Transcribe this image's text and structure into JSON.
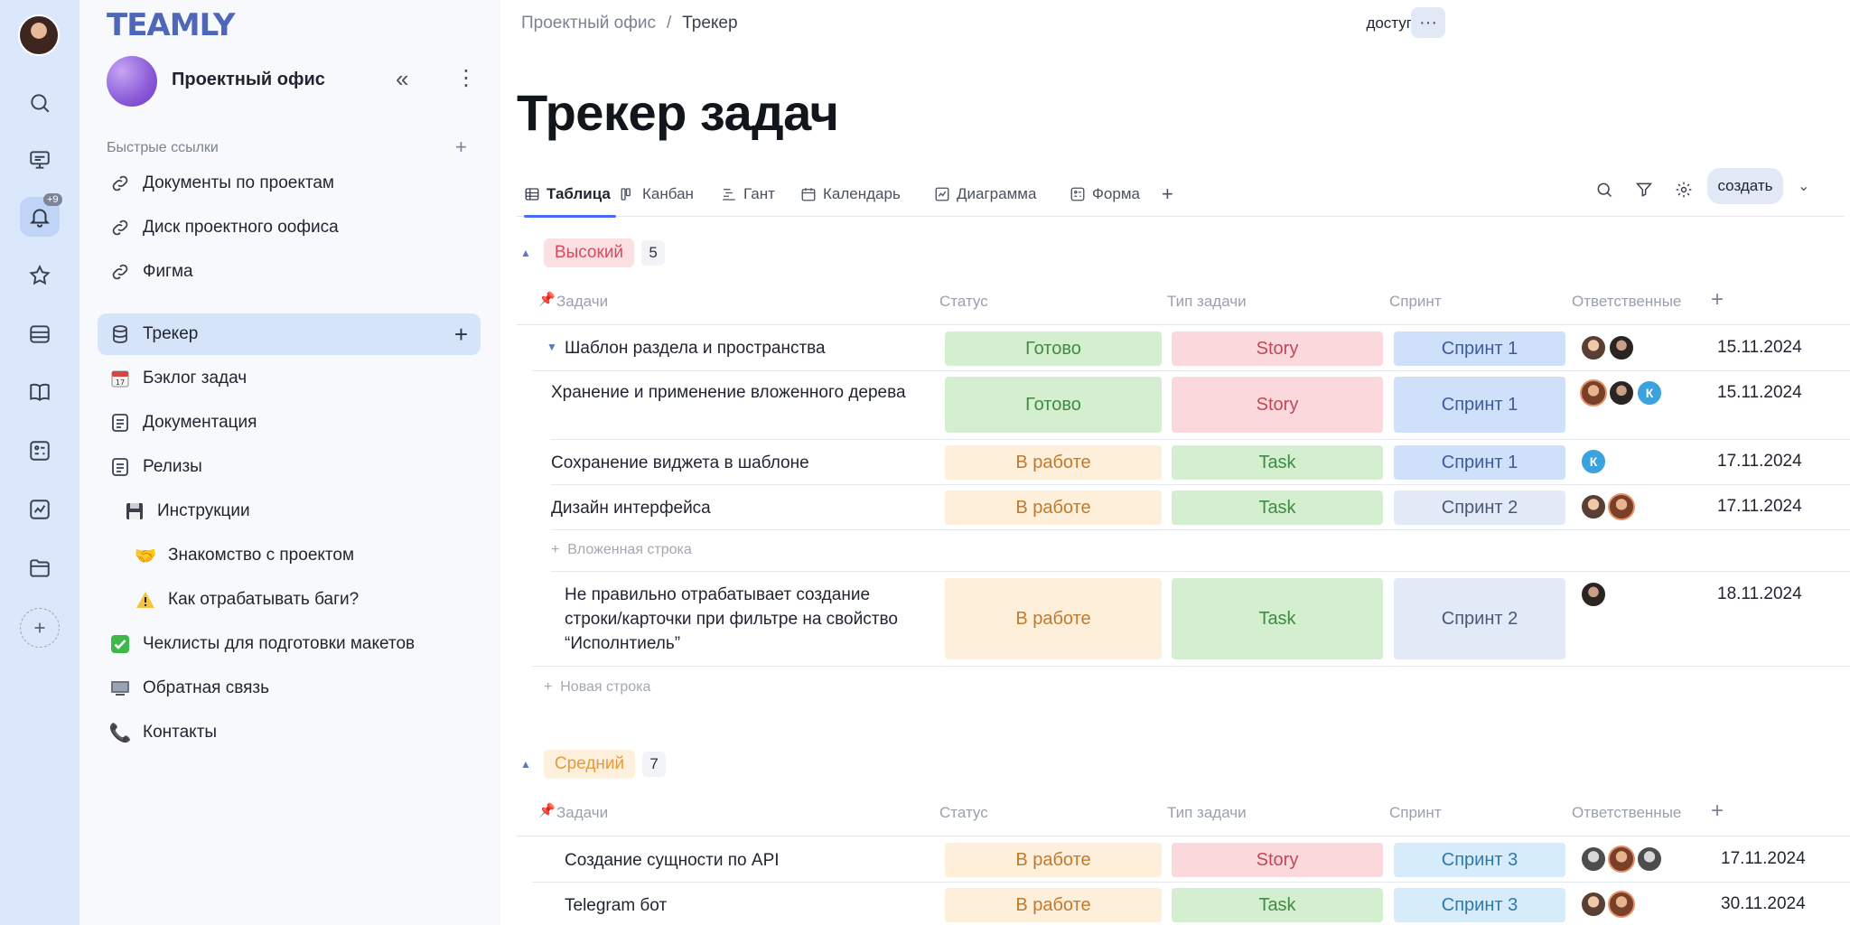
{
  "app": {
    "logo": "TEAMLY",
    "notifications_badge": "+9"
  },
  "sidebar": {
    "workspace": "Проектный офис",
    "quick_links_title": "Быстрые ссылки",
    "quick_links": [
      "Документы по проектам",
      "Диск проектного оофиса",
      "Фигма"
    ],
    "items": [
      {
        "label": "Трекер",
        "icon": "database-icon"
      },
      {
        "label": "Бэклог задач",
        "icon": "calendar-emoji-icon"
      },
      {
        "label": "Документация",
        "icon": "document-icon"
      },
      {
        "label": "Релизы",
        "icon": "document-icon"
      },
      {
        "label": "Инструкции",
        "icon": "floppy-icon"
      },
      {
        "label": "Знакомство с проектом",
        "icon": "handshake-icon"
      },
      {
        "label": "Как отрабатывать баги?",
        "icon": "warning-icon"
      },
      {
        "label": "Чеклисты для подготовки макетов",
        "icon": "checkmark-icon"
      },
      {
        "label": "Обратная связь",
        "icon": "monitor-icon"
      },
      {
        "label": "Контакты",
        "icon": "phone-icon"
      }
    ]
  },
  "header": {
    "breadcrumb": [
      "Проектный офис",
      "Трекер"
    ],
    "access_label": "доступ",
    "title": "Трекер задач"
  },
  "tabs": [
    "Таблица",
    "Канбан",
    "Гант",
    "Календарь",
    "Диаграмма",
    "Форма"
  ],
  "toolbar": {
    "create_label": "создать"
  },
  "columns": [
    "Задачи",
    "Статус",
    "Тип задачи",
    "Спринт",
    "Ответственные"
  ],
  "groups": [
    {
      "name": "Высокий",
      "count": "5",
      "color": "#fbe0e3",
      "text_color": "#d54a5c",
      "rows": [
        {
          "title": "Шаблон раздела и пространства",
          "status": "Готово",
          "type": "Story",
          "sprint": "Спринт 1",
          "date": "15.11.2024"
        },
        {
          "title": "Хранение и применение вложенного дерева",
          "status": "Готово",
          "type": "Story",
          "sprint": "Спринт 1",
          "date": "15.11.2024"
        },
        {
          "title": "Сохранение виджета в шаблоне",
          "status": "В работе",
          "type": "Task",
          "sprint": "Спринт 1",
          "date": "17.11.2024"
        },
        {
          "title": "Дизайн интерфейса",
          "status": "В работе",
          "type": "Task",
          "sprint": "Спринт 2",
          "date": "17.11.2024"
        },
        {
          "title": "Не правильно отрабатывает создание строки/карточки при фильтре на свойство “Исполнтиель”",
          "status": "В работе",
          "type": "Task",
          "sprint": "Спринт 2",
          "date": "18.11.2024"
        }
      ],
      "nested_row_label": "Вложенная строка",
      "new_row_label": "Новая строка"
    },
    {
      "name": "Средний",
      "count": "7",
      "color": "#fdf0dc",
      "text_color": "#e69a3a",
      "rows": [
        {
          "title": "Создание сущности по API",
          "status": "В работе",
          "type": "Story",
          "sprint": "Спринт 3",
          "date": "17.11.2024"
        },
        {
          "title": "Telegram бот",
          "status": "В работе",
          "type": "Task",
          "sprint": "Спринт 3",
          "date": "30.11.2024"
        }
      ]
    }
  ],
  "avatar_initial": "К"
}
